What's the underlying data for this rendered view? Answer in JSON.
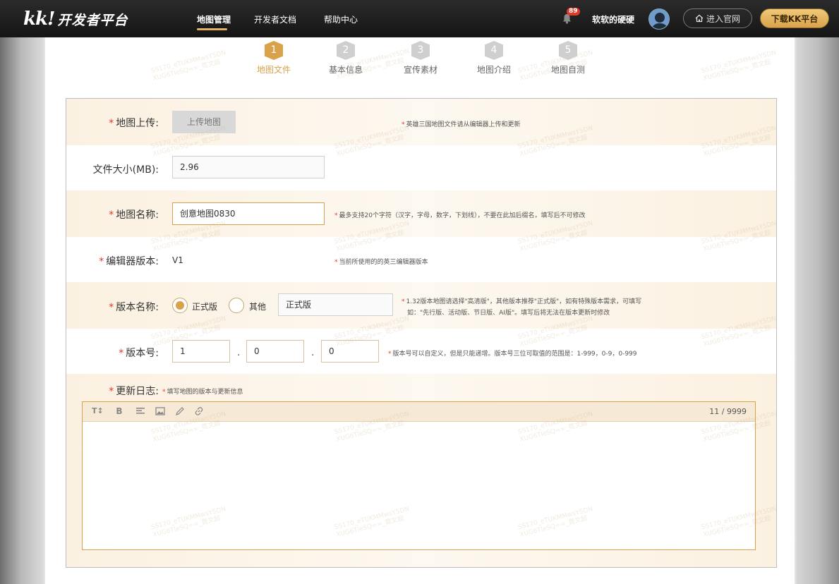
{
  "header": {
    "logo_mark": "kk!",
    "logo_text": "开发者平台",
    "nav": [
      {
        "label": "地图管理",
        "active": true
      },
      {
        "label": "开发者文档",
        "active": false
      },
      {
        "label": "帮助中心",
        "active": false
      }
    ],
    "notification_count": "89",
    "username": "软软的硬硬",
    "official_button": "进入官网",
    "download_button": "下载KK平台"
  },
  "steps": [
    {
      "num": "1",
      "label": "地图文件",
      "active": true
    },
    {
      "num": "2",
      "label": "基本信息",
      "active": false
    },
    {
      "num": "3",
      "label": "宣传素材",
      "active": false
    },
    {
      "num": "4",
      "label": "地图介绍",
      "active": false
    },
    {
      "num": "5",
      "label": "地图自测",
      "active": false
    }
  ],
  "form": {
    "upload": {
      "label": "地图上传:",
      "button": "上传地图",
      "hint": "英雄三国地图文件请从编辑器上传和更新"
    },
    "filesize": {
      "label": "文件大小(MB):",
      "value": "2.96"
    },
    "mapname": {
      "label": "地图名称:",
      "value": "创意地图0830",
      "hint": "最多支持20个字符（汉字，字母，数字，下划线），不要在此加后缀名，填写后不可修改"
    },
    "editor_version": {
      "label": "编辑器版本:",
      "value": "V1",
      "hint": "当前所使用的的英三编辑器版本"
    },
    "version_name": {
      "label": "版本名称:",
      "option_official": "正式版",
      "option_other": "其他",
      "value": "正式版",
      "hint_line1": "1.32版本地图请选择\"高清版\"，其他版本推荐\"正式版\"，如有特殊版本需求，可填写",
      "hint_line2": "如：\"先行版、活动版、节日版、AI版\"。填写后将无法在版本更新时修改"
    },
    "version_number": {
      "label": "版本号:",
      "major": "1",
      "minor": "0",
      "patch": "0",
      "separator": ".",
      "hint": "版本号可以自定义，但是只能递增。版本号三位可取值的范围是：1-999，0-9，0-999"
    },
    "changelog": {
      "label": "更新日志:",
      "hint": "填写地图的版本与更新信息",
      "counter": "11 / 9999",
      "tools": [
        "text-size-icon",
        "bold-icon",
        "align-icon",
        "image-icon",
        "pen-icon",
        "link-icon"
      ]
    }
  },
  "colors": {
    "accent": "#d9a24a",
    "required": "#e03a2a",
    "topbar": "#1c1c1c"
  }
}
